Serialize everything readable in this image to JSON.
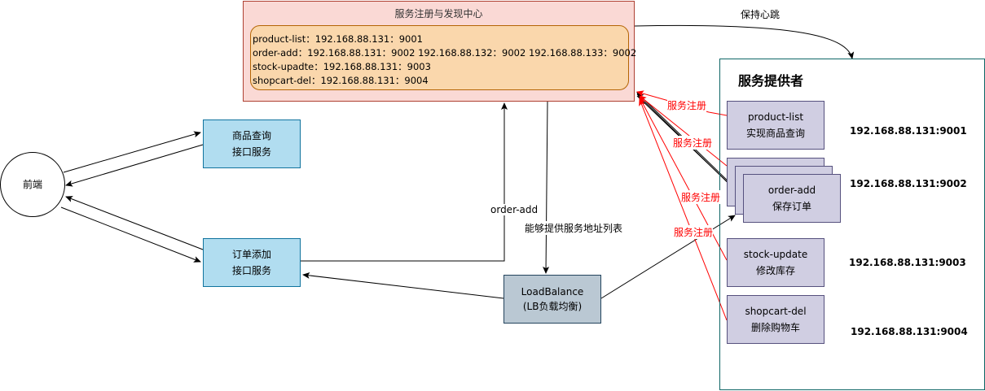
{
  "registry": {
    "title": "服务注册与发现中心",
    "entries": [
      "product-list：192.168.88.131：9001",
      "order-add：192.168.88.131：9002  192.168.88.132：9002  192.168.88.133：9002",
      "stock-upadte：192.168.88.131：9003",
      "shopcart-del：192.168.88.131：9004"
    ]
  },
  "frontend": {
    "label": "前端"
  },
  "consumers": {
    "product_query": [
      "商品查询",
      "接口服务"
    ],
    "order_add": [
      "订单添加",
      "接口服务"
    ]
  },
  "loadbalance": [
    "LoadBalance",
    "(LB负载均衡)"
  ],
  "providers": {
    "title": "服务提供者",
    "items": [
      {
        "name": "product-list",
        "desc": "实现商品查询",
        "ip": "192.168.88.131:9001"
      },
      {
        "name": "order-add",
        "desc": "保存订单",
        "ip": "192.168.88.131:9002"
      },
      {
        "name": "stock-update",
        "desc": "修改库存",
        "ip": "192.168.88.131:9003"
      },
      {
        "name": "shopcart-del",
        "desc": "删除购物车",
        "ip": "192.168.88.131:9004"
      }
    ]
  },
  "edge_labels": {
    "heartbeat": "保持心跳",
    "order_add": "order-add",
    "address_list": "能够提供服务地址列表",
    "register": "服务注册"
  },
  "colors": {
    "registry_fill": "#fad9d5",
    "registry_border": "#ae4132",
    "registry_inner_fill": "#fad7ac",
    "registry_inner_border": "#b46504",
    "provider_container_border": "#0e6666",
    "register_arrow": "#ff0000"
  }
}
